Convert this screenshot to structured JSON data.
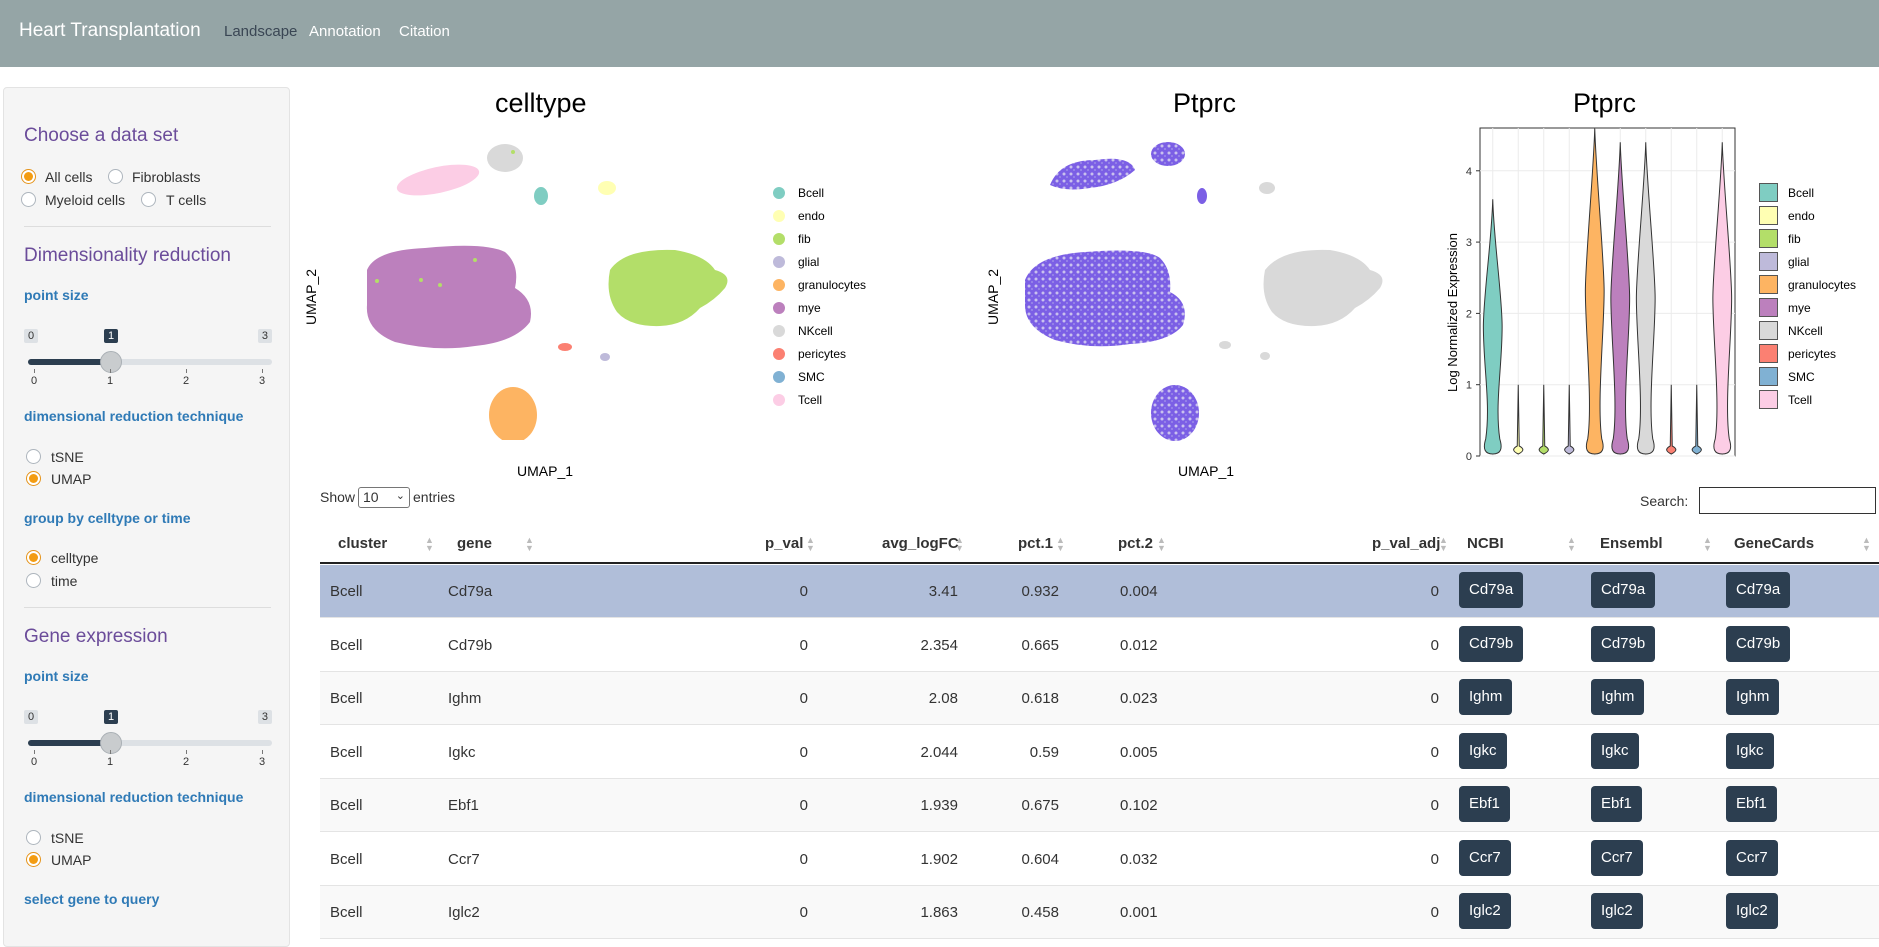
{
  "navbar": {
    "brand": "Heart Transplantation",
    "links": [
      {
        "label": "Landscape",
        "active": true
      },
      {
        "label": "Annotation",
        "active": false
      },
      {
        "label": "Citation",
        "active": false
      }
    ]
  },
  "sidebar": {
    "dataset": {
      "title": "Choose a data set",
      "options": [
        "All cells",
        "Fibroblasts",
        "Myeloid cells",
        "T cells"
      ],
      "selected": "All cells"
    },
    "dimred": {
      "title": "Dimensionality reduction",
      "point_size": {
        "label": "point size",
        "min": "0",
        "max": "3",
        "value": "1",
        "ticks": [
          "0",
          "1",
          "2",
          "3"
        ]
      },
      "technique": {
        "label": "dimensional reduction technique",
        "options": [
          "tSNE",
          "UMAP"
        ],
        "selected": "UMAP"
      },
      "group": {
        "label": "group by celltype or time",
        "options": [
          "celltype",
          "time"
        ],
        "selected": "celltype"
      }
    },
    "gene_expr": {
      "title": "Gene expression",
      "point_size": {
        "label": "point size",
        "min": "0",
        "max": "3",
        "value": "1",
        "ticks": [
          "0",
          "1",
          "2",
          "3"
        ]
      },
      "technique": {
        "label": "dimensional reduction technique",
        "options": [
          "tSNE",
          "UMAP"
        ],
        "selected": "UMAP"
      },
      "select_gene_label": "select gene to query"
    }
  },
  "plots": {
    "umap_celltype": {
      "title": "celltype",
      "xlabel": "UMAP_1",
      "ylabel": "UMAP_2"
    },
    "umap_gene": {
      "title": "Ptprc",
      "xlabel": "UMAP_1",
      "ylabel": "UMAP_2"
    },
    "violin": {
      "title": "Ptprc",
      "ylabel": "Log Normalized Expression",
      "yticks": [
        "0",
        "1",
        "2",
        "3",
        "4"
      ]
    },
    "legend": [
      {
        "name": "Bcell",
        "color": "#7fcdc2"
      },
      {
        "name": "endo",
        "color": "#ffffb3"
      },
      {
        "name": "fib",
        "color": "#b3de69"
      },
      {
        "name": "glial",
        "color": "#bebada"
      },
      {
        "name": "granulocytes",
        "color": "#fdb462"
      },
      {
        "name": "mye",
        "color": "#bc80bd"
      },
      {
        "name": "NKcell",
        "color": "#d9d9d9"
      },
      {
        "name": "pericytes",
        "color": "#fb8072"
      },
      {
        "name": "SMC",
        "color": "#80b1d3"
      },
      {
        "name": "Tcell",
        "color": "#fccde5"
      }
    ],
    "gene_colors": {
      "low": "#d9d9d9",
      "high": "#6a4fe0"
    }
  },
  "chart_data": {
    "type": "violin",
    "title": "Ptprc",
    "ylabel": "Log Normalized Expression",
    "ylim": [
      0,
      4.6
    ],
    "categories": [
      "Bcell",
      "endo",
      "fib",
      "glial",
      "granulocytes",
      "mye",
      "NKcell",
      "pericytes",
      "SMC",
      "Tcell"
    ],
    "max_values": [
      3.6,
      1.0,
      1.0,
      1.0,
      4.6,
      4.4,
      4.4,
      1.0,
      1.0,
      4.4
    ]
  },
  "table": {
    "show_label": "Show",
    "entries_value": "10",
    "entries_label": "entries",
    "search_label": "Search:",
    "columns": [
      "cluster",
      "gene",
      "p_val",
      "avg_logFC",
      "pct.1",
      "pct.2",
      "p_val_adj",
      "NCBI",
      "Ensembl",
      "GeneCards"
    ],
    "rows": [
      {
        "cluster": "Bcell",
        "gene": "Cd79a",
        "p_val": "0",
        "avg_logFC": "3.41",
        "pct1": "0.932",
        "pct2": "0.004",
        "p_val_adj": "0",
        "selected": true
      },
      {
        "cluster": "Bcell",
        "gene": "Cd79b",
        "p_val": "0",
        "avg_logFC": "2.354",
        "pct1": "0.665",
        "pct2": "0.012",
        "p_val_adj": "0"
      },
      {
        "cluster": "Bcell",
        "gene": "Ighm",
        "p_val": "0",
        "avg_logFC": "2.08",
        "pct1": "0.618",
        "pct2": "0.023",
        "p_val_adj": "0"
      },
      {
        "cluster": "Bcell",
        "gene": "Igkc",
        "p_val": "0",
        "avg_logFC": "2.044",
        "pct1": "0.59",
        "pct2": "0.005",
        "p_val_adj": "0"
      },
      {
        "cluster": "Bcell",
        "gene": "Ebf1",
        "p_val": "0",
        "avg_logFC": "1.939",
        "pct1": "0.675",
        "pct2": "0.102",
        "p_val_adj": "0"
      },
      {
        "cluster": "Bcell",
        "gene": "Ccr7",
        "p_val": "0",
        "avg_logFC": "1.902",
        "pct1": "0.604",
        "pct2": "0.032",
        "p_val_adj": "0"
      },
      {
        "cluster": "Bcell",
        "gene": "Iglc2",
        "p_val": "0",
        "avg_logFC": "1.863",
        "pct1": "0.458",
        "pct2": "0.001",
        "p_val_adj": "0"
      }
    ]
  }
}
